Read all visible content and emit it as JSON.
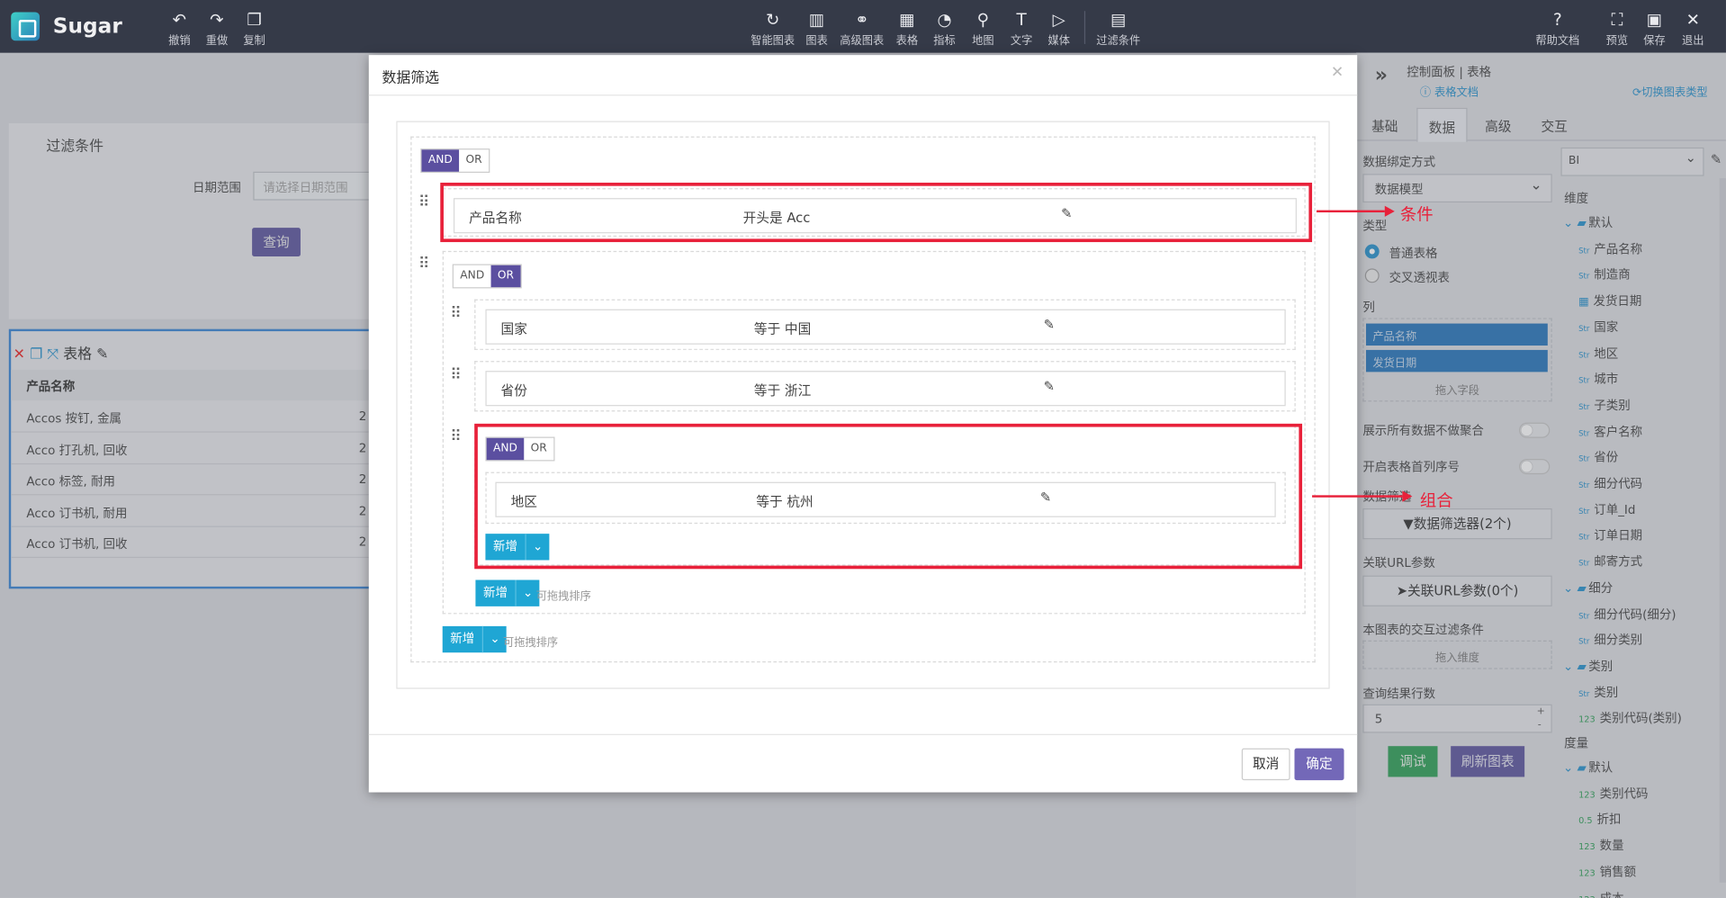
{
  "app": {
    "name": "Sugar"
  },
  "toolbar_left": [
    {
      "icon": "undo-icon",
      "glyph": "↶",
      "label": "撤销"
    },
    {
      "icon": "redo-icon",
      "glyph": "↷",
      "label": "重做"
    },
    {
      "icon": "copy-icon",
      "glyph": "❐",
      "label": "复制"
    }
  ],
  "toolbar_center": [
    {
      "icon": "smart-chart-icon",
      "glyph": "↻",
      "label": "智能图表"
    },
    {
      "icon": "chart-icon",
      "glyph": "▥",
      "label": "图表"
    },
    {
      "icon": "advanced-chart-icon",
      "glyph": "⚭",
      "label": "高级图表"
    },
    {
      "icon": "table-icon",
      "glyph": "▦",
      "label": "表格"
    },
    {
      "icon": "indicator-icon",
      "glyph": "◔",
      "label": "指标"
    },
    {
      "icon": "map-icon",
      "glyph": "⚲",
      "label": "地图"
    },
    {
      "icon": "text-icon",
      "glyph": "T",
      "label": "文字"
    },
    {
      "icon": "media-icon",
      "glyph": "▷",
      "label": "媒体"
    },
    {
      "icon": "filter-condition-icon",
      "glyph": "▤",
      "label": "过滤条件"
    }
  ],
  "toolbar_right": [
    {
      "icon": "help-icon",
      "glyph": "?",
      "label": "帮助文档"
    },
    {
      "icon": "preview-icon",
      "glyph": "⛶",
      "label": "预览"
    },
    {
      "icon": "save-icon",
      "glyph": "▣",
      "label": "保存"
    },
    {
      "icon": "exit-icon",
      "glyph": "✕",
      "label": "退出"
    }
  ],
  "background": {
    "filter_title": "过滤条件",
    "date_label": "日期范围",
    "date_placeholder": "请选择日期范围",
    "query_button": "查询",
    "table_title": "表格",
    "table_column": "产品名称",
    "table_rows": [
      {
        "name": "Accos 按钉, 金属",
        "num": "2"
      },
      {
        "name": "Acco 打孔机, 回收",
        "num": "2"
      },
      {
        "name": "Acco 标签, 耐用",
        "num": "2"
      },
      {
        "name": "Acco 订书机, 耐用",
        "num": "2"
      },
      {
        "name": "Acco 订书机, 回收",
        "num": "2"
      }
    ]
  },
  "right_panel": {
    "breadcrumb": "控制面板 | 表格",
    "doc_link": "表格文档",
    "switch_link": "切换图表类型",
    "tabs": [
      "基础",
      "数据",
      "高级",
      "交互"
    ],
    "active_tab": "数据",
    "bind_label": "数据绑定方式",
    "bind_value": "数据模型",
    "type_label": "类型",
    "type_options": [
      "普通表格",
      "交叉透视表"
    ],
    "column_label": "列",
    "columns": [
      "产品名称",
      "发货日期"
    ],
    "drop_field": "拖入字段",
    "show_all_label": "展示所有数据不做聚合",
    "serial_label": "开启表格首列序号",
    "filter_label": "数据筛选",
    "filter_button": "数据筛选器(2个)",
    "url_label": "关联URL参数",
    "url_button": "关联URL参数(0个)",
    "interaction_label": "本图表的交互过滤条件",
    "drop_dimension": "拖入维度",
    "rows_label": "查询结果行数",
    "rows_value": "5",
    "debug_button": "调试",
    "refresh_button": "刷新图表",
    "source": "BI",
    "dimension_label": "维度",
    "measure_label": "度量",
    "fields": [
      {
        "kind": "group",
        "name": "默认"
      },
      {
        "kind": "Str",
        "name": "产品名称"
      },
      {
        "kind": "Str",
        "name": "制造商"
      },
      {
        "kind": "date",
        "name": "发货日期"
      },
      {
        "kind": "Str",
        "name": "国家"
      },
      {
        "kind": "Str",
        "name": "地区"
      },
      {
        "kind": "Str",
        "name": "城市"
      },
      {
        "kind": "Str",
        "name": "子类别"
      },
      {
        "kind": "Str",
        "name": "客户名称"
      },
      {
        "kind": "Str",
        "name": "省份"
      },
      {
        "kind": "Str",
        "name": "细分代码"
      },
      {
        "kind": "Str",
        "name": "订单_Id"
      },
      {
        "kind": "Str",
        "name": "订单日期"
      },
      {
        "kind": "Str",
        "name": "邮寄方式"
      },
      {
        "kind": "group",
        "name": "细分"
      },
      {
        "kind": "Str",
        "name": "细分代码(细分)"
      },
      {
        "kind": "Str",
        "name": "细分类别"
      },
      {
        "kind": "group",
        "name": "类别"
      },
      {
        "kind": "Str",
        "name": "类别"
      },
      {
        "kind": "123",
        "name": "类别代码(类别)"
      }
    ],
    "measures": [
      {
        "kind": "group",
        "name": "默认"
      },
      {
        "kind": "123",
        "name": "类别代码"
      },
      {
        "kind": "0.5",
        "name": "折扣"
      },
      {
        "kind": "123",
        "name": "数量"
      },
      {
        "kind": "123",
        "name": "销售额"
      },
      {
        "kind": "123",
        "name": "成本"
      }
    ]
  },
  "modal": {
    "title": "数据筛选",
    "logic_and": "AND",
    "logic_or": "OR",
    "condition1": {
      "field": "产品名称",
      "op": "开头是 Acc"
    },
    "group": {
      "conditions": [
        {
          "field": "国家",
          "op": "等于 中国"
        },
        {
          "field": "省份",
          "op": "等于 浙江"
        }
      ],
      "subgroup": {
        "field": "地区",
        "op": "等于 杭州"
      }
    },
    "add_label": "新增",
    "sortable_hint": "可拖拽排序",
    "cancel": "取消",
    "confirm": "确定"
  },
  "annotations": {
    "condition": "条件",
    "group": "组合"
  },
  "colors": {
    "topbar": "#353a48",
    "accent": "#5b4fa0",
    "add": "#1fa6d4",
    "annotation": "#e8213a"
  }
}
